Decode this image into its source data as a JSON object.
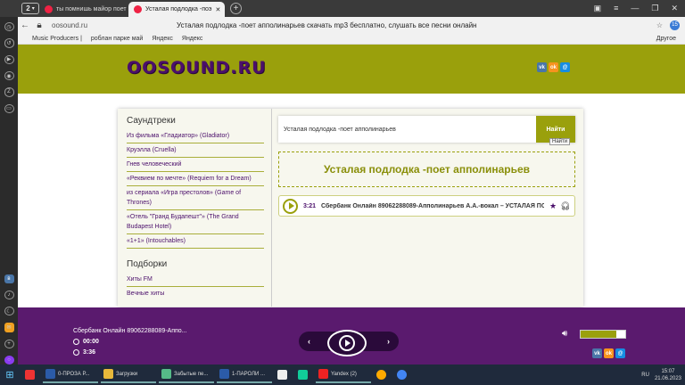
{
  "browser": {
    "tab_count": "2",
    "tabs": [
      {
        "label": "ты помнишь майор поет"
      },
      {
        "label": "Усталая подлодка -поэ"
      }
    ],
    "url": "oosound.ru",
    "page_title": "Усталая подлодка -поет апполинарьев скачать mp3 бесплатно, слушать все песни онлайн",
    "downloads_badge": "15",
    "bookmarks": [
      "Music Producers |",
      "роблан парке май",
      "Яндекс",
      "Яндекс"
    ],
    "bookmarks_more": "Другое"
  },
  "site": {
    "logo": "OOSOUND.RU",
    "sidebar": {
      "soundtracks_title": "Саундтреки",
      "soundtracks": [
        "Из фильма «Гладиатор» (Gladiator)",
        "Круэлла (Cruella)",
        "Гнев человеческий",
        "«Реквием по мечте» (Requiem for a Dream)",
        "из сериала «Игра престолов» (Game of Thrones)",
        "«Отель \"Гранд Будапешт\"» (The Grand Budapest Hotel)",
        "«1+1» (Intouchables)"
      ],
      "collections_title": "Подборки",
      "collections": [
        "Хиты FM",
        "Вечные хиты"
      ]
    },
    "search": {
      "value": "Усталая подлодка -поет апполинарьев",
      "button": "Найти",
      "tooltip": "Найти"
    },
    "result_title": "Усталая подлодка -поет апполинарьев",
    "track": {
      "duration": "3:21",
      "title": "Сбербанк Онлайн 89062288089-Апполинарьев А.А.-вокал – УСТАЛАЯ ПОДЛОДКА"
    }
  },
  "player": {
    "title": "Сбербанк Онлайн 89062288089-Аппо...",
    "elapsed": "00:00",
    "total": "3:36",
    "volume": 0.8
  },
  "taskbar": {
    "items": [
      {
        "label": "0-ПРОЗА Р..."
      },
      {
        "label": "Загрузки"
      },
      {
        "label": "Забытые пе..."
      },
      {
        "label": "1-ПАРОЛИ ..."
      },
      {
        "label": "Yandex (2)"
      }
    ],
    "lang": "RU",
    "time": "15:07",
    "date": "21.06.2023"
  }
}
